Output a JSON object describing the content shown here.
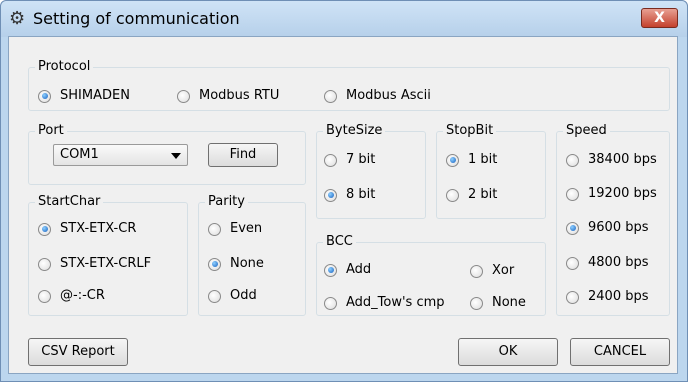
{
  "window": {
    "title": "Setting of communication",
    "close_label": "X"
  },
  "protocol": {
    "legend": "Protocol",
    "options": [
      {
        "label": "SHIMADEN",
        "selected": true
      },
      {
        "label": "Modbus RTU",
        "selected": false
      },
      {
        "label": "Modbus Ascii",
        "selected": false
      }
    ]
  },
  "port": {
    "legend": "Port",
    "selected": "COM1",
    "find_label": "Find"
  },
  "startchar": {
    "legend": "StartChar",
    "options": [
      {
        "label": "STX-ETX-CR",
        "selected": true
      },
      {
        "label": "STX-ETX-CRLF",
        "selected": false
      },
      {
        "label": "@-:-CR",
        "selected": false
      }
    ]
  },
  "parity": {
    "legend": "Parity",
    "options": [
      {
        "label": "Even",
        "selected": false
      },
      {
        "label": "None",
        "selected": true
      },
      {
        "label": "Odd",
        "selected": false
      }
    ]
  },
  "bytesize": {
    "legend": "ByteSize",
    "options": [
      {
        "label": "7 bit",
        "selected": false
      },
      {
        "label": "8 bit",
        "selected": true
      }
    ]
  },
  "stopbit": {
    "legend": "StopBit",
    "options": [
      {
        "label": "1 bit",
        "selected": true
      },
      {
        "label": "2 bit",
        "selected": false
      }
    ]
  },
  "bcc": {
    "legend": "BCC",
    "options": [
      {
        "label": "Add",
        "selected": true
      },
      {
        "label": "Xor",
        "selected": false
      },
      {
        "label": "Add_Tow's cmp",
        "selected": false
      },
      {
        "label": "None",
        "selected": false
      }
    ]
  },
  "speed": {
    "legend": "Speed",
    "options": [
      {
        "label": "38400 bps",
        "selected": false
      },
      {
        "label": "19200 bps",
        "selected": false
      },
      {
        "label": "9600 bps",
        "selected": true
      },
      {
        "label": "4800 bps",
        "selected": false
      },
      {
        "label": "2400 bps",
        "selected": false
      }
    ]
  },
  "buttons": {
    "csv_report": "CSV Report",
    "ok": "OK",
    "cancel": "CANCEL"
  },
  "icons": {
    "title_icon": "gear-icon",
    "close_icon": "close-icon",
    "dropdown_icon": "chevron-down-icon"
  },
  "colors": {
    "titlebar": "#c3daf1",
    "close_button": "#c4412d",
    "radio_selected": "#1560c0"
  }
}
